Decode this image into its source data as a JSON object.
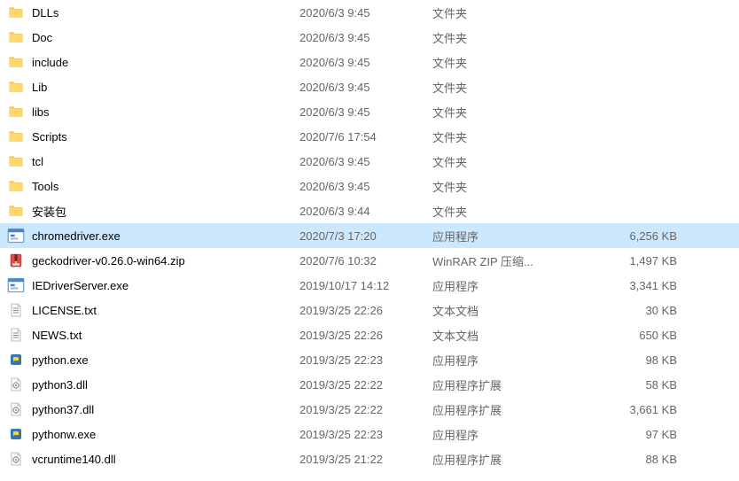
{
  "files": [
    {
      "name": "DLLs",
      "date": "2020/6/3 9:45",
      "type": "文件夹",
      "size": "",
      "icon": "folder",
      "selected": false
    },
    {
      "name": "Doc",
      "date": "2020/6/3 9:45",
      "type": "文件夹",
      "size": "",
      "icon": "folder",
      "selected": false
    },
    {
      "name": "include",
      "date": "2020/6/3 9:45",
      "type": "文件夹",
      "size": "",
      "icon": "folder",
      "selected": false
    },
    {
      "name": "Lib",
      "date": "2020/6/3 9:45",
      "type": "文件夹",
      "size": "",
      "icon": "folder",
      "selected": false
    },
    {
      "name": "libs",
      "date": "2020/6/3 9:45",
      "type": "文件夹",
      "size": "",
      "icon": "folder",
      "selected": false
    },
    {
      "name": "Scripts",
      "date": "2020/7/6 17:54",
      "type": "文件夹",
      "size": "",
      "icon": "folder",
      "selected": false
    },
    {
      "name": "tcl",
      "date": "2020/6/3 9:45",
      "type": "文件夹",
      "size": "",
      "icon": "folder",
      "selected": false
    },
    {
      "name": "Tools",
      "date": "2020/6/3 9:45",
      "type": "文件夹",
      "size": "",
      "icon": "folder",
      "selected": false
    },
    {
      "name": "安装包",
      "date": "2020/6/3 9:44",
      "type": "文件夹",
      "size": "",
      "icon": "folder",
      "selected": false
    },
    {
      "name": "chromedriver.exe",
      "date": "2020/7/3 17:20",
      "type": "应用程序",
      "size": "6,256 KB",
      "icon": "exe-blue",
      "selected": true
    },
    {
      "name": "geckodriver-v0.26.0-win64.zip",
      "date": "2020/7/6 10:32",
      "type": "WinRAR ZIP 压缩...",
      "size": "1,497 KB",
      "icon": "zip",
      "selected": false
    },
    {
      "name": "IEDriverServer.exe",
      "date": "2019/10/17 14:12",
      "type": "应用程序",
      "size": "3,341 KB",
      "icon": "exe-blue",
      "selected": false
    },
    {
      "name": "LICENSE.txt",
      "date": "2019/3/25 22:26",
      "type": "文本文档",
      "size": "30 KB",
      "icon": "txt",
      "selected": false
    },
    {
      "name": "NEWS.txt",
      "date": "2019/3/25 22:26",
      "type": "文本文档",
      "size": "650 KB",
      "icon": "txt",
      "selected": false
    },
    {
      "name": "python.exe",
      "date": "2019/3/25 22:23",
      "type": "应用程序",
      "size": "98 KB",
      "icon": "py",
      "selected": false
    },
    {
      "name": "python3.dll",
      "date": "2019/3/25 22:22",
      "type": "应用程序扩展",
      "size": "58 KB",
      "icon": "dll",
      "selected": false
    },
    {
      "name": "python37.dll",
      "date": "2019/3/25 22:22",
      "type": "应用程序扩展",
      "size": "3,661 KB",
      "icon": "dll",
      "selected": false
    },
    {
      "name": "pythonw.exe",
      "date": "2019/3/25 22:23",
      "type": "应用程序",
      "size": "97 KB",
      "icon": "py",
      "selected": false
    },
    {
      "name": "vcruntime140.dll",
      "date": "2019/3/25 21:22",
      "type": "应用程序扩展",
      "size": "88 KB",
      "icon": "dll",
      "selected": false
    }
  ]
}
